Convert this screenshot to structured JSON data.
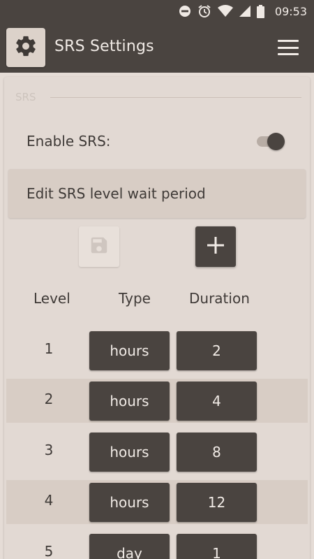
{
  "status_bar": {
    "time": "09:53",
    "icons": [
      "do-not-disturb-icon",
      "alarm-icon",
      "wifi-icon",
      "signal-icon",
      "battery-icon"
    ]
  },
  "app_bar": {
    "title": "SRS Settings",
    "left_icon": "gear-icon",
    "right_icon": "menu-icon"
  },
  "settings": {
    "section_label": "SRS",
    "enable_label": "Enable SRS:",
    "enable_on": true,
    "edit_label": "Edit SRS level wait period"
  },
  "table": {
    "headers": [
      "Level",
      "Type",
      "Duration"
    ],
    "rows": [
      {
        "level": "1",
        "type": "hours",
        "duration": "2"
      },
      {
        "level": "2",
        "type": "hours",
        "duration": "4"
      },
      {
        "level": "3",
        "type": "hours",
        "duration": "8"
      },
      {
        "level": "4",
        "type": "hours",
        "duration": "12"
      },
      {
        "level": "5",
        "type": "day",
        "duration": "1"
      }
    ]
  },
  "colors": {
    "primary_dark": "#4a4440",
    "background": "#e5dcd6",
    "panel": "#d8cdc5"
  }
}
